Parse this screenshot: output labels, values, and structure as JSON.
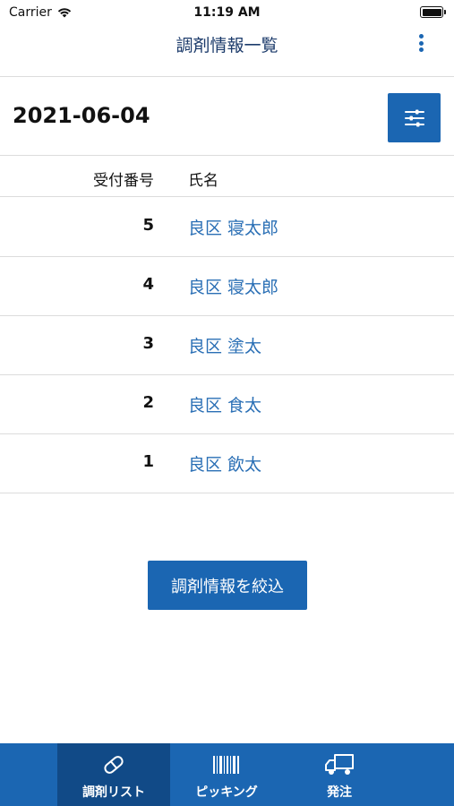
{
  "status_bar": {
    "carrier": "Carrier",
    "time": "11:19 AM"
  },
  "nav": {
    "title": "調剤情報一覧",
    "menu_icon": "more-vertical-icon"
  },
  "date_row": {
    "date": "2021-06-04",
    "filter_icon": "sliders-icon"
  },
  "table": {
    "headers": {
      "number": "受付番号",
      "name": "氏名"
    },
    "rows": [
      {
        "number": "5",
        "name": "良区 寝太郎"
      },
      {
        "number": "4",
        "name": "良区 寝太郎"
      },
      {
        "number": "3",
        "name": "良区 塗太"
      },
      {
        "number": "2",
        "name": "良区 食太"
      },
      {
        "number": "1",
        "name": "良区 飲太"
      }
    ]
  },
  "narrow_button": {
    "label": "調剤情報を絞込"
  },
  "tabs": [
    {
      "label": "調剤リスト",
      "icon": "pill-icon",
      "active": true
    },
    {
      "label": "ピッキング",
      "icon": "barcode-icon",
      "active": false
    },
    {
      "label": "発注",
      "icon": "truck-icon",
      "active": false
    }
  ],
  "colors": {
    "primary": "#1b66b2",
    "primary_dark": "#114a87",
    "link": "#2a6fb5",
    "title": "#1c3b6b"
  }
}
